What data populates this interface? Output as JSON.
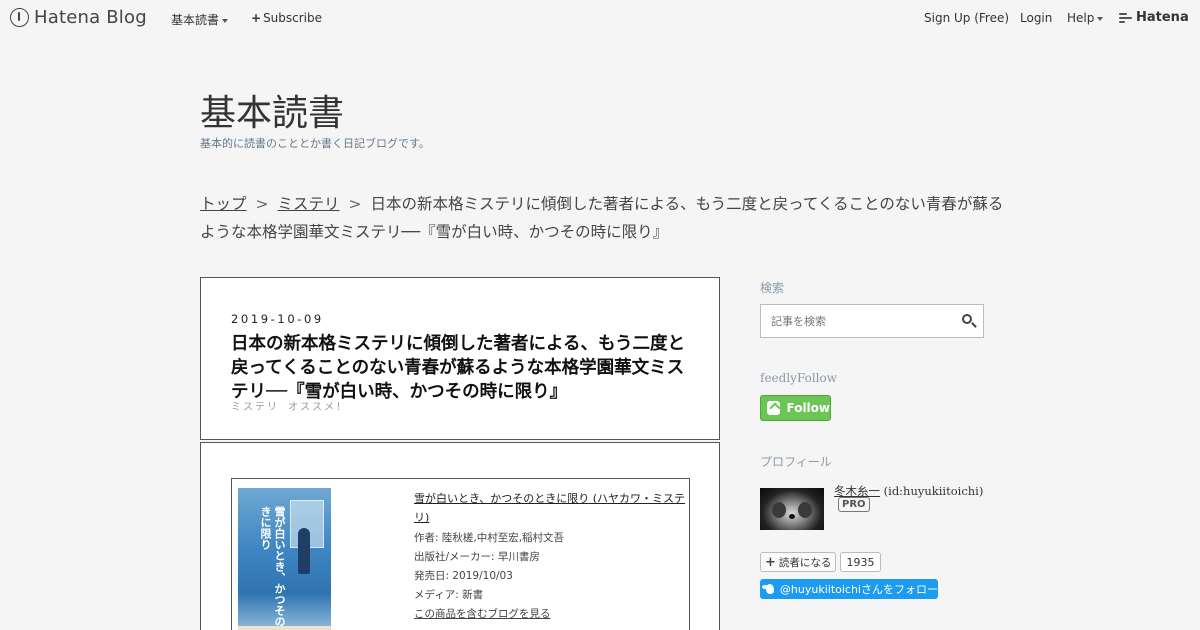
{
  "global_header": {
    "logo_text": "Hatena Blog",
    "dokusho_menu": "基本読書",
    "subscribe": "Subscribe",
    "signup": "Sign Up (Free)",
    "login": "Login",
    "help": "Help",
    "brand": "Hatena"
  },
  "blog": {
    "title": "基本読書",
    "description": "基本的に読書のこととか書く日記ブログです。"
  },
  "breadcrumb": {
    "top": "トップ",
    "separator": ">",
    "category": "ミステリ",
    "current": "日本の新本格ミステリに傾倒した著者による、もう二度と戻ってくることのない青春が蘇るような本格学園華文ミステリ──『雪が白い時、かつその時に限り』"
  },
  "article": {
    "date": "2019-10-09",
    "title": "日本の新本格ミステリに傾倒した著者による、もう二度と戻ってくることのない青春が蘇るような本格学園華文ミステリ──『雪が白い時、かつその時に限り』",
    "categories": [
      "ミステリ",
      "オススメ！"
    ],
    "product": {
      "title": "雪が白いとき、かつそのときに限り (ハヤカワ・ミステリ)",
      "cover_text": "雪が白いとき、かつそのときに限り",
      "author": "作者: 陸秋槎,中村至宏,稲村文吾",
      "publisher": "出版社/メーカー: 早川書房",
      "release": "発売日: 2019/10/03",
      "media": "メディア: 新書",
      "link": "この商品を含むブログを見る"
    }
  },
  "sidebar": {
    "search_heading": "検索",
    "search_placeholder": "記事を検索",
    "feedly_heading": "feedlyFollow",
    "follow_label": "Follow",
    "profile_heading": "プロフィール",
    "profile_name": "冬木糸一",
    "profile_id": " (id:huyukiitoichi)",
    "pro_badge": "PRO",
    "subscribe_label": "読者になる",
    "subscriber_count": "1935",
    "twitter_follow": "@huyukiitoichiさんをフォロー"
  },
  "colors": {
    "background": "#f5f5f5",
    "feedly_green": "#6cc655",
    "twitter_blue": "#1d9bf0",
    "sidebar_heading": "#8a9aaa"
  }
}
